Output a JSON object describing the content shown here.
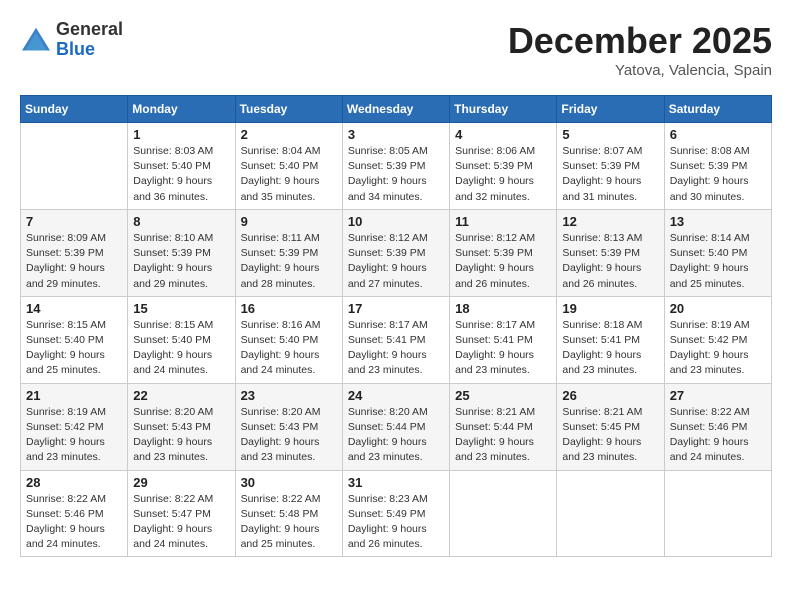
{
  "header": {
    "logo_general": "General",
    "logo_blue": "Blue",
    "month": "December 2025",
    "location": "Yatova, Valencia, Spain"
  },
  "weekdays": [
    "Sunday",
    "Monday",
    "Tuesday",
    "Wednesday",
    "Thursday",
    "Friday",
    "Saturday"
  ],
  "weeks": [
    [
      {
        "day": "",
        "sunrise": "",
        "sunset": "",
        "daylight": ""
      },
      {
        "day": "1",
        "sunrise": "Sunrise: 8:03 AM",
        "sunset": "Sunset: 5:40 PM",
        "daylight": "Daylight: 9 hours and 36 minutes."
      },
      {
        "day": "2",
        "sunrise": "Sunrise: 8:04 AM",
        "sunset": "Sunset: 5:40 PM",
        "daylight": "Daylight: 9 hours and 35 minutes."
      },
      {
        "day": "3",
        "sunrise": "Sunrise: 8:05 AM",
        "sunset": "Sunset: 5:39 PM",
        "daylight": "Daylight: 9 hours and 34 minutes."
      },
      {
        "day": "4",
        "sunrise": "Sunrise: 8:06 AM",
        "sunset": "Sunset: 5:39 PM",
        "daylight": "Daylight: 9 hours and 32 minutes."
      },
      {
        "day": "5",
        "sunrise": "Sunrise: 8:07 AM",
        "sunset": "Sunset: 5:39 PM",
        "daylight": "Daylight: 9 hours and 31 minutes."
      },
      {
        "day": "6",
        "sunrise": "Sunrise: 8:08 AM",
        "sunset": "Sunset: 5:39 PM",
        "daylight": "Daylight: 9 hours and 30 minutes."
      }
    ],
    [
      {
        "day": "7",
        "sunrise": "Sunrise: 8:09 AM",
        "sunset": "Sunset: 5:39 PM",
        "daylight": "Daylight: 9 hours and 29 minutes."
      },
      {
        "day": "8",
        "sunrise": "Sunrise: 8:10 AM",
        "sunset": "Sunset: 5:39 PM",
        "daylight": "Daylight: 9 hours and 29 minutes."
      },
      {
        "day": "9",
        "sunrise": "Sunrise: 8:11 AM",
        "sunset": "Sunset: 5:39 PM",
        "daylight": "Daylight: 9 hours and 28 minutes."
      },
      {
        "day": "10",
        "sunrise": "Sunrise: 8:12 AM",
        "sunset": "Sunset: 5:39 PM",
        "daylight": "Daylight: 9 hours and 27 minutes."
      },
      {
        "day": "11",
        "sunrise": "Sunrise: 8:12 AM",
        "sunset": "Sunset: 5:39 PM",
        "daylight": "Daylight: 9 hours and 26 minutes."
      },
      {
        "day": "12",
        "sunrise": "Sunrise: 8:13 AM",
        "sunset": "Sunset: 5:39 PM",
        "daylight": "Daylight: 9 hours and 26 minutes."
      },
      {
        "day": "13",
        "sunrise": "Sunrise: 8:14 AM",
        "sunset": "Sunset: 5:40 PM",
        "daylight": "Daylight: 9 hours and 25 minutes."
      }
    ],
    [
      {
        "day": "14",
        "sunrise": "Sunrise: 8:15 AM",
        "sunset": "Sunset: 5:40 PM",
        "daylight": "Daylight: 9 hours and 25 minutes."
      },
      {
        "day": "15",
        "sunrise": "Sunrise: 8:15 AM",
        "sunset": "Sunset: 5:40 PM",
        "daylight": "Daylight: 9 hours and 24 minutes."
      },
      {
        "day": "16",
        "sunrise": "Sunrise: 8:16 AM",
        "sunset": "Sunset: 5:40 PM",
        "daylight": "Daylight: 9 hours and 24 minutes."
      },
      {
        "day": "17",
        "sunrise": "Sunrise: 8:17 AM",
        "sunset": "Sunset: 5:41 PM",
        "daylight": "Daylight: 9 hours and 23 minutes."
      },
      {
        "day": "18",
        "sunrise": "Sunrise: 8:17 AM",
        "sunset": "Sunset: 5:41 PM",
        "daylight": "Daylight: 9 hours and 23 minutes."
      },
      {
        "day": "19",
        "sunrise": "Sunrise: 8:18 AM",
        "sunset": "Sunset: 5:41 PM",
        "daylight": "Daylight: 9 hours and 23 minutes."
      },
      {
        "day": "20",
        "sunrise": "Sunrise: 8:19 AM",
        "sunset": "Sunset: 5:42 PM",
        "daylight": "Daylight: 9 hours and 23 minutes."
      }
    ],
    [
      {
        "day": "21",
        "sunrise": "Sunrise: 8:19 AM",
        "sunset": "Sunset: 5:42 PM",
        "daylight": "Daylight: 9 hours and 23 minutes."
      },
      {
        "day": "22",
        "sunrise": "Sunrise: 8:20 AM",
        "sunset": "Sunset: 5:43 PM",
        "daylight": "Daylight: 9 hours and 23 minutes."
      },
      {
        "day": "23",
        "sunrise": "Sunrise: 8:20 AM",
        "sunset": "Sunset: 5:43 PM",
        "daylight": "Daylight: 9 hours and 23 minutes."
      },
      {
        "day": "24",
        "sunrise": "Sunrise: 8:20 AM",
        "sunset": "Sunset: 5:44 PM",
        "daylight": "Daylight: 9 hours and 23 minutes."
      },
      {
        "day": "25",
        "sunrise": "Sunrise: 8:21 AM",
        "sunset": "Sunset: 5:44 PM",
        "daylight": "Daylight: 9 hours and 23 minutes."
      },
      {
        "day": "26",
        "sunrise": "Sunrise: 8:21 AM",
        "sunset": "Sunset: 5:45 PM",
        "daylight": "Daylight: 9 hours and 23 minutes."
      },
      {
        "day": "27",
        "sunrise": "Sunrise: 8:22 AM",
        "sunset": "Sunset: 5:46 PM",
        "daylight": "Daylight: 9 hours and 24 minutes."
      }
    ],
    [
      {
        "day": "28",
        "sunrise": "Sunrise: 8:22 AM",
        "sunset": "Sunset: 5:46 PM",
        "daylight": "Daylight: 9 hours and 24 minutes."
      },
      {
        "day": "29",
        "sunrise": "Sunrise: 8:22 AM",
        "sunset": "Sunset: 5:47 PM",
        "daylight": "Daylight: 9 hours and 24 minutes."
      },
      {
        "day": "30",
        "sunrise": "Sunrise: 8:22 AM",
        "sunset": "Sunset: 5:48 PM",
        "daylight": "Daylight: 9 hours and 25 minutes."
      },
      {
        "day": "31",
        "sunrise": "Sunrise: 8:23 AM",
        "sunset": "Sunset: 5:49 PM",
        "daylight": "Daylight: 9 hours and 26 minutes."
      },
      {
        "day": "",
        "sunrise": "",
        "sunset": "",
        "daylight": ""
      },
      {
        "day": "",
        "sunrise": "",
        "sunset": "",
        "daylight": ""
      },
      {
        "day": "",
        "sunrise": "",
        "sunset": "",
        "daylight": ""
      }
    ]
  ]
}
